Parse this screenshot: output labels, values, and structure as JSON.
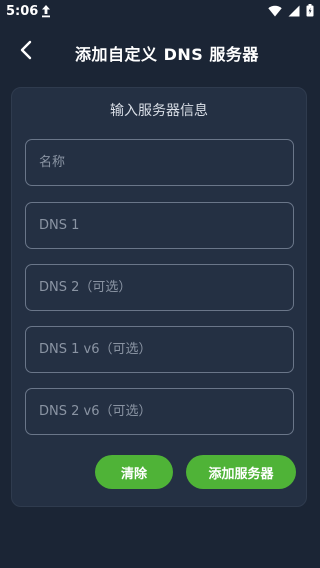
{
  "status_bar": {
    "time": "5:06",
    "icons": [
      "upload-icon",
      "wifi-icon",
      "cell-signal-icon",
      "battery-icon"
    ]
  },
  "app_bar": {
    "back_icon": "chevron-left-icon",
    "title": "添加自定义 DNS 服务器"
  },
  "form": {
    "title": "输入服务器信息",
    "fields": [
      {
        "placeholder": "名称",
        "value": ""
      },
      {
        "placeholder": "DNS 1",
        "value": ""
      },
      {
        "placeholder": "DNS 2（可选）",
        "value": ""
      },
      {
        "placeholder": "DNS 1 v6（可选）",
        "value": ""
      },
      {
        "placeholder": "DNS 2 v6（可选）",
        "value": ""
      }
    ],
    "clear_label": "清除",
    "add_label": "添加服务器"
  },
  "colors": {
    "background": "#1b2535",
    "card": "#243043",
    "accent": "#4fb337",
    "field_border": "#6a7689"
  }
}
